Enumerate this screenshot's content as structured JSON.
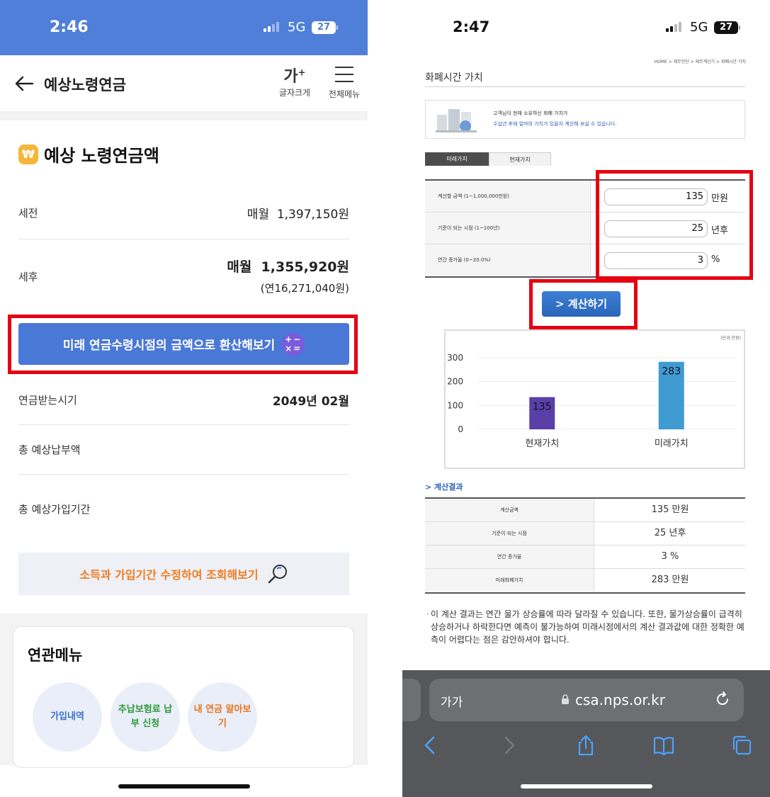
{
  "left": {
    "status": {
      "time": "2:46",
      "network": "5G",
      "battery": "27"
    },
    "header": {
      "title": "예상노령연금",
      "font_size_glyph": "가",
      "font_size_sup": "+",
      "font_size_label": "글자크게",
      "menu_label": "전체메뉴"
    },
    "section": {
      "badge": "₩",
      "title": "예상 노령연금액"
    },
    "rows": {
      "pretax_label": "세전",
      "pretax_value": "매월  1,397,150원",
      "posttax_label": "세후",
      "posttax_value": "매월  1,355,920원",
      "posttax_annual": "(연16,271,040원)",
      "start_label": "연금받는시기",
      "start_value": "2049년 02월",
      "total_paid_label": "총 예상납부액",
      "total_period_label": "총 예상가입기간"
    },
    "convert_button": "미래 연금수령시점의 금액으로 환산해보기",
    "calc_icon_top": "+−",
    "calc_icon_bottom": "×=",
    "modify_button": "소득과 가입기간 수정하여 조회해보기",
    "related": {
      "title": "연관메뉴",
      "items": [
        {
          "label": "가입내역",
          "color": "#3b6fd0"
        },
        {
          "label": "추납보험료 납부 신청",
          "color": "#2f9a3c"
        },
        {
          "label": "내 연금 알아보기",
          "color": "#e8731a"
        }
      ]
    },
    "accent_color": "#4a78d6"
  },
  "right": {
    "status": {
      "time": "2:47",
      "network": "5G",
      "battery": "27"
    },
    "breadcrumb": "HOME > 재무진단 > 재무계산기 > 화폐시간 가치",
    "page_title": "화폐시간 가치",
    "info_line1": "고객님이 현재 소유하신 화폐 가치가",
    "info_line2": "수십년 후에 얼마의 가치가 있을지 계산해 보실 수 있습니다.",
    "tabs": [
      "미래가치",
      "현재가치"
    ],
    "form": [
      {
        "label": "계산할 금액 (1~1,000,000만원)",
        "value": "135",
        "unit": "만원"
      },
      {
        "label": "기준이 되는 시점 (1~100년)",
        "value": "25",
        "unit": "년후"
      },
      {
        "label": "연간 증가율 (0~20.0%)",
        "value": "3",
        "unit": "%"
      }
    ],
    "calc_button": "> 계산하기",
    "result_heading": "> 계산결과",
    "results": [
      {
        "label": "계산금액",
        "value": "135 만원"
      },
      {
        "label": "기준이 되는 시점",
        "value": "25 년후"
      },
      {
        "label": "연간 증가율",
        "value": "3 %"
      },
      {
        "label": "미래화폐가치",
        "value": "283 만원"
      }
    ],
    "note": "이 계산 결과는 연간 물가 상승률에 따라 달라질 수 있습니다. 또한, 물가상승률이 급격히 상승하거나 하락한다면 예측이 불가능하여 미래시점에서의 계산 결과값에 대한 정확한 예측이 어렵다는 점은 감안하셔야 합니다.",
    "browser": {
      "aa": "가가",
      "url": "csa.nps.or.kr"
    }
  },
  "chart_data": {
    "type": "bar",
    "unit_label": "(단위:만원)",
    "categories": [
      "현재가치",
      "미래가치"
    ],
    "values": [
      135,
      283
    ],
    "colors": [
      "#5a3fa8",
      "#3f9bd2"
    ],
    "yticks": [
      0,
      100,
      200,
      300
    ],
    "ylim": [
      0,
      300
    ],
    "grid": true
  }
}
